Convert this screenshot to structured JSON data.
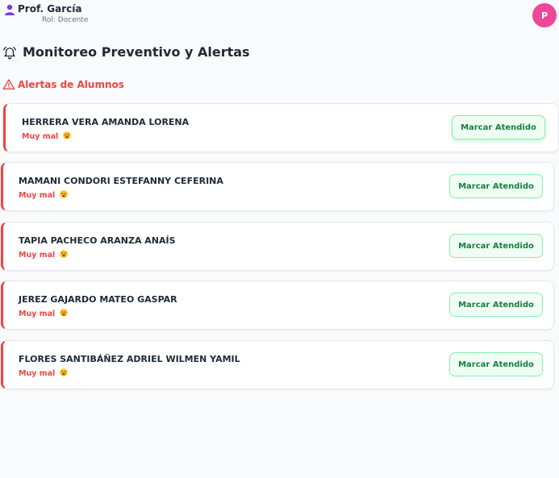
{
  "header": {
    "user_name": "Prof. García",
    "user_role": "Rol: Docente",
    "avatar_initial": "P"
  },
  "page": {
    "title": "Monitoreo Preventivo y Alertas",
    "section_title": "Alertas de Alumnos"
  },
  "icons": {
    "user": "user-icon",
    "bell": "bell-icon",
    "warning": "warning-triangle-icon",
    "status_emoji": "tired-face-emoji-icon"
  },
  "colors": {
    "alert_red": "#ef4444",
    "button_green": "#15803d",
    "avatar_pink": "#ec4899"
  },
  "alerts": [
    {
      "name": "HERRERA VERA AMANDA LORENA",
      "status": "Muy mal",
      "action": "Marcar Atendido"
    },
    {
      "name": "MAMANI CONDORI ESTEFANNY CEFERINA",
      "status": "Muy mal",
      "action": "Marcar Atendido"
    },
    {
      "name": "TAPIA PACHECO ARANZA ANAÍS",
      "status": "Muy mal",
      "action": "Marcar Atendido"
    },
    {
      "name": "JEREZ GAJARDO MATEO GASPAR",
      "status": "Muy mal",
      "action": "Marcar Atendido"
    },
    {
      "name": "FLORES SANTIBÁÑEZ ADRIEL WILMEN YAMIL",
      "status": "Muy mal",
      "action": "Marcar Atendido"
    }
  ]
}
